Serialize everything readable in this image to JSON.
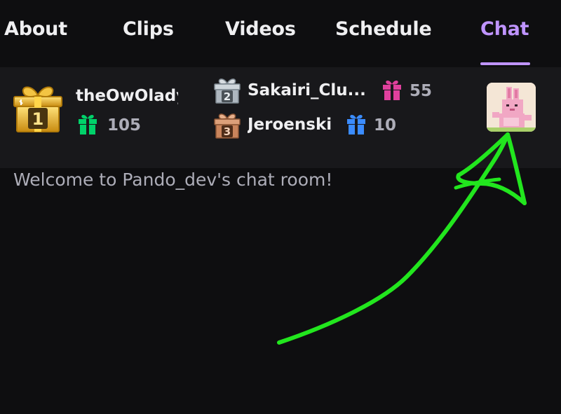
{
  "tabs": [
    {
      "label": "About",
      "active": false
    },
    {
      "label": "Clips",
      "active": false
    },
    {
      "label": "Videos",
      "active": false
    },
    {
      "label": "Schedule",
      "active": false
    },
    {
      "label": "Chat",
      "active": true
    }
  ],
  "leaderboard": {
    "first": {
      "rank": "1",
      "name": "theOwOlady",
      "gifts": "105",
      "gift_color": "#00d26a"
    },
    "second": {
      "rank": "2",
      "name": "Sakairi_Clu...",
      "gifts": "55",
      "gift_color": "#e0409d"
    },
    "third": {
      "rank": "3",
      "name": "Jeroenski",
      "gifts": "10",
      "gift_color": "#3b8cff"
    },
    "avatar_icon": "pink-bunny-avatar-icon"
  },
  "chat": {
    "welcome_message": "Welcome to Pando_dev's chat room!"
  },
  "colors": {
    "accent": "#bf94ff",
    "background": "#0e0e10",
    "panel": "#18181b",
    "muted_text": "#adadb8",
    "annotation": "#22e61e"
  }
}
